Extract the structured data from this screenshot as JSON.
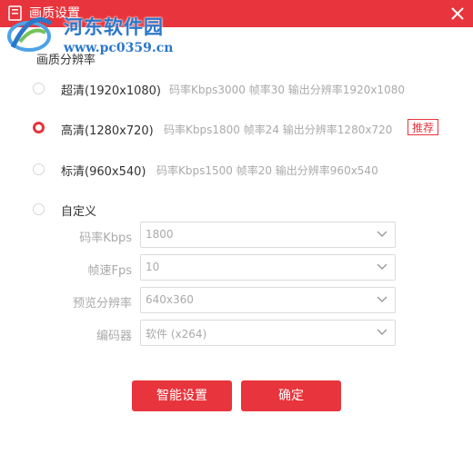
{
  "window": {
    "title": "画质设置"
  },
  "watermark": {
    "name": "河东软件园",
    "url": "www.pc0359.cn"
  },
  "section": {
    "label": "画质分辨率"
  },
  "options": [
    {
      "label": "超清(1920x1080)",
      "desc": "码率Kbps3000 帧率30 输出分辨率1920x1080",
      "checked": false
    },
    {
      "label": "高清(1280x720)",
      "desc": "码率Kbps1800 帧率24 输出分辨率1280x720",
      "checked": true,
      "badge": "推荐"
    },
    {
      "label": "标清(960x540)",
      "desc": "码率Kbps1500 帧率20 输出分辨率960x540",
      "checked": false
    },
    {
      "label": "自定义",
      "checked": false
    }
  ],
  "custom": {
    "fields": [
      {
        "label": "码率Kbps",
        "value": "1800"
      },
      {
        "label": "帧速Fps",
        "value": "10"
      },
      {
        "label": "预览分辨率",
        "value": "640x360"
      },
      {
        "label": "编码器",
        "value": "软件 (x264)"
      }
    ]
  },
  "buttons": {
    "smart": "智能设置",
    "ok": "确定"
  },
  "colors": {
    "accent": "#e8343c",
    "watermark": "#2b77c9"
  }
}
